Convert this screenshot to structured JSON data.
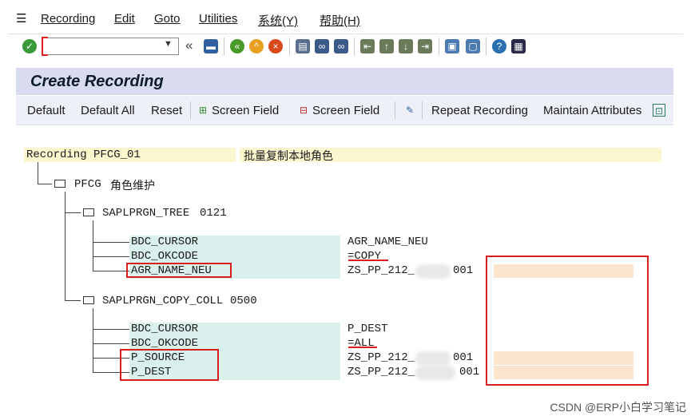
{
  "menu": {
    "items": [
      "Recording",
      "Edit",
      "Goto",
      "Utilities",
      "系统(Y)",
      "帮助(H)"
    ]
  },
  "toolbar": {
    "command_field_value": "",
    "collapse_symbol": "«",
    "icons": [
      "check-icon",
      "save-icon",
      "back-icon",
      "exit-icon",
      "cancel-icon",
      "print-icon",
      "find-icon",
      "find-next-icon",
      "first-page-icon",
      "previous-page-icon",
      "next-page-icon",
      "last-page-icon",
      "create-session-icon",
      "shortcut-icon",
      "help-icon",
      "customize-layout-icon"
    ],
    "colors": {
      "check": "#3a9a3a",
      "back": "#4a9a2a",
      "exit": "#e8a020",
      "cancel": "#d84a1a",
      "help": "#2a6fb0"
    }
  },
  "page": {
    "title": "Create Recording"
  },
  "app_toolbar": {
    "default_label": "Default",
    "default_all_label": "Default All",
    "reset_label": "Reset",
    "insert_screen_field_label": "Screen Field",
    "delete_screen_field_label": "Screen Field",
    "repeat_recording_label": "Repeat Recording",
    "maintain_attributes_label": "Maintain Attributes"
  },
  "recording": {
    "name": "Recording PFCG_01",
    "description": "批量复制本地角色",
    "transaction": {
      "code": "PFCG",
      "text": "角色维护"
    },
    "screens": [
      {
        "program": "SAPLPRGN_TREE",
        "dynpro": "0121",
        "fields": [
          {
            "name": "BDC_CURSOR",
            "value": "AGR_NAME_NEU"
          },
          {
            "name": "BDC_OKCODE",
            "value": "=COPY"
          },
          {
            "name": "AGR_NAME_NEU",
            "value": "ZS_PP_212_",
            "value_suffix": "001"
          }
        ]
      },
      {
        "program": "SAPLPRGN_COPY_COLL",
        "dynpro": "0500",
        "fields": [
          {
            "name": "BDC_CURSOR",
            "value": "P_DEST"
          },
          {
            "name": "BDC_OKCODE",
            "value": "=ALL"
          },
          {
            "name": "P_SOURCE",
            "value": "ZS_PP_212_",
            "value_suffix": "001"
          },
          {
            "name": "P_DEST",
            "value": "ZS_PP_212_",
            "value_suffix": "001"
          }
        ]
      }
    ]
  },
  "watermark": "CSDN @ERP小白学习笔记"
}
